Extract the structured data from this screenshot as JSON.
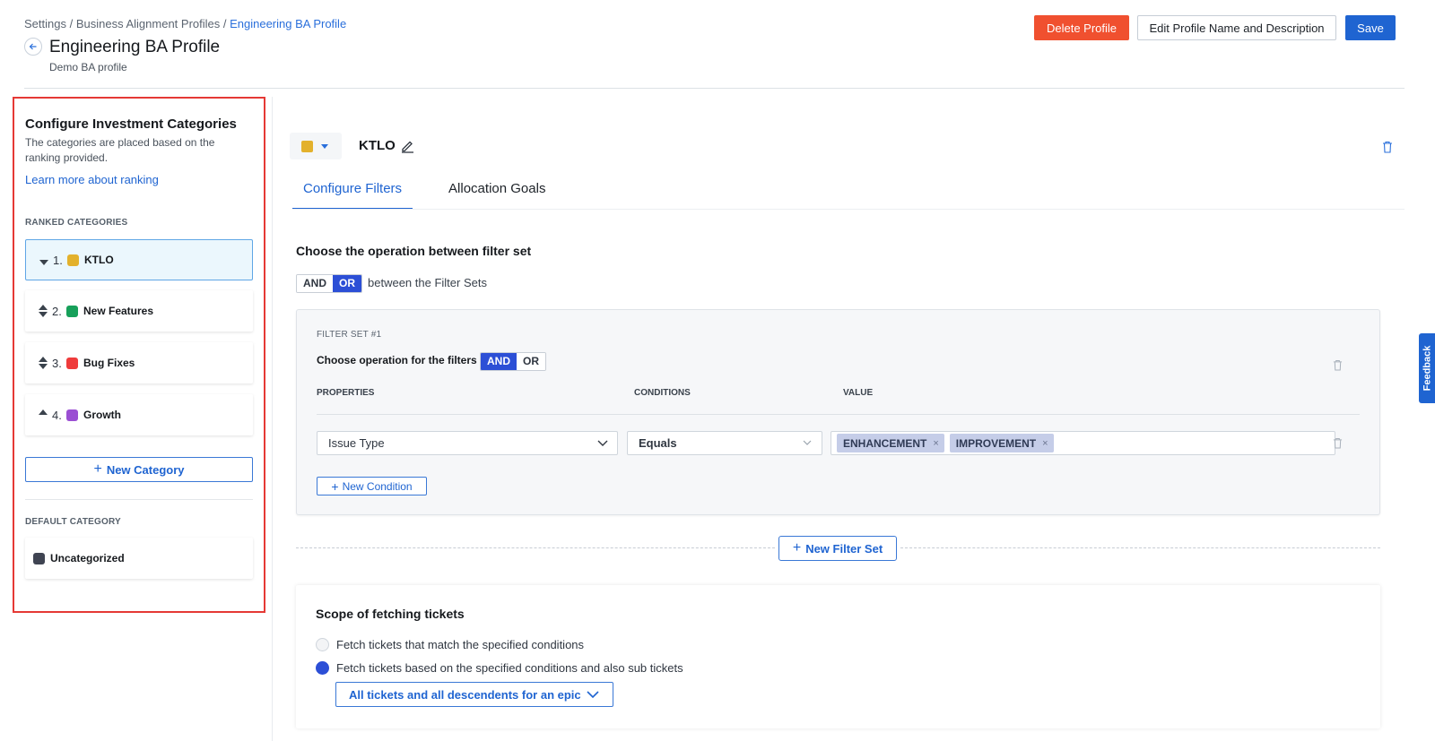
{
  "breadcrumb": {
    "items": [
      "Settings",
      "Business Alignment Profiles"
    ],
    "separator": " / ",
    "current": "Engineering BA Profile"
  },
  "header": {
    "title": "Engineering BA Profile",
    "subtitle": "Demo BA profile",
    "delete_label": "Delete Profile",
    "edit_label": "Edit Profile Name and Description",
    "save_label": "Save"
  },
  "sidebar": {
    "title": "Configure Investment Categories",
    "description": "The categories are placed based on the ranking provided.",
    "learn_more": "Learn more about ranking",
    "ranked_heading": "RANKED CATEGORIES",
    "categories": [
      {
        "rank": "1.",
        "label": "KTLO",
        "color": "#e3b12c",
        "selected": true
      },
      {
        "rank": "2.",
        "label": "New Features",
        "color": "#17a05a",
        "selected": false
      },
      {
        "rank": "3.",
        "label": "Bug Fixes",
        "color": "#ef3b3b",
        "selected": false
      },
      {
        "rank": "4.",
        "label": "Growth",
        "color": "#9b4fd3",
        "selected": false
      }
    ],
    "new_category_label": "New Category",
    "default_heading": "DEFAULT CATEGORY",
    "default_category": {
      "label": "Uncategorized",
      "color": "#3f4452"
    }
  },
  "category_detail": {
    "name": "KTLO",
    "color": "#e3b12c",
    "tabs": [
      {
        "label": "Configure Filters",
        "active": true
      },
      {
        "label": "Allocation Goals",
        "active": false
      }
    ]
  },
  "filters": {
    "operation_title": "Choose the operation between filter set",
    "operation_options": [
      "AND",
      "OR"
    ],
    "operation_selected": "OR",
    "operation_suffix": "between the Filter Sets",
    "filter_set": {
      "label": "FILTER SET #1",
      "op_title": "Choose operation for the filters",
      "op_options": [
        "AND",
        "OR"
      ],
      "op_selected": "AND",
      "columns": [
        "PROPERTIES",
        "CONDITIONS",
        "VALUE"
      ],
      "condition": {
        "property": "Issue Type",
        "operator": "Equals",
        "values": [
          "ENHANCEMENT",
          "IMPROVEMENT"
        ]
      },
      "new_condition_label": "New Condition"
    },
    "new_filter_set_label": "New Filter Set"
  },
  "scope": {
    "title": "Scope of fetching tickets",
    "options": [
      {
        "label": "Fetch tickets that match the specified conditions",
        "checked": false
      },
      {
        "label": "Fetch tickets based on the specified conditions and also sub tickets",
        "checked": true
      }
    ],
    "dropdown_value": "All tickets and all descendents for an epic"
  },
  "feedback_label": "Feedback",
  "colors": {
    "accent": "#1f64d1",
    "danger": "#f0502f",
    "toggle_on": "#2c4fd6",
    "highlight_border": "#e53935"
  }
}
